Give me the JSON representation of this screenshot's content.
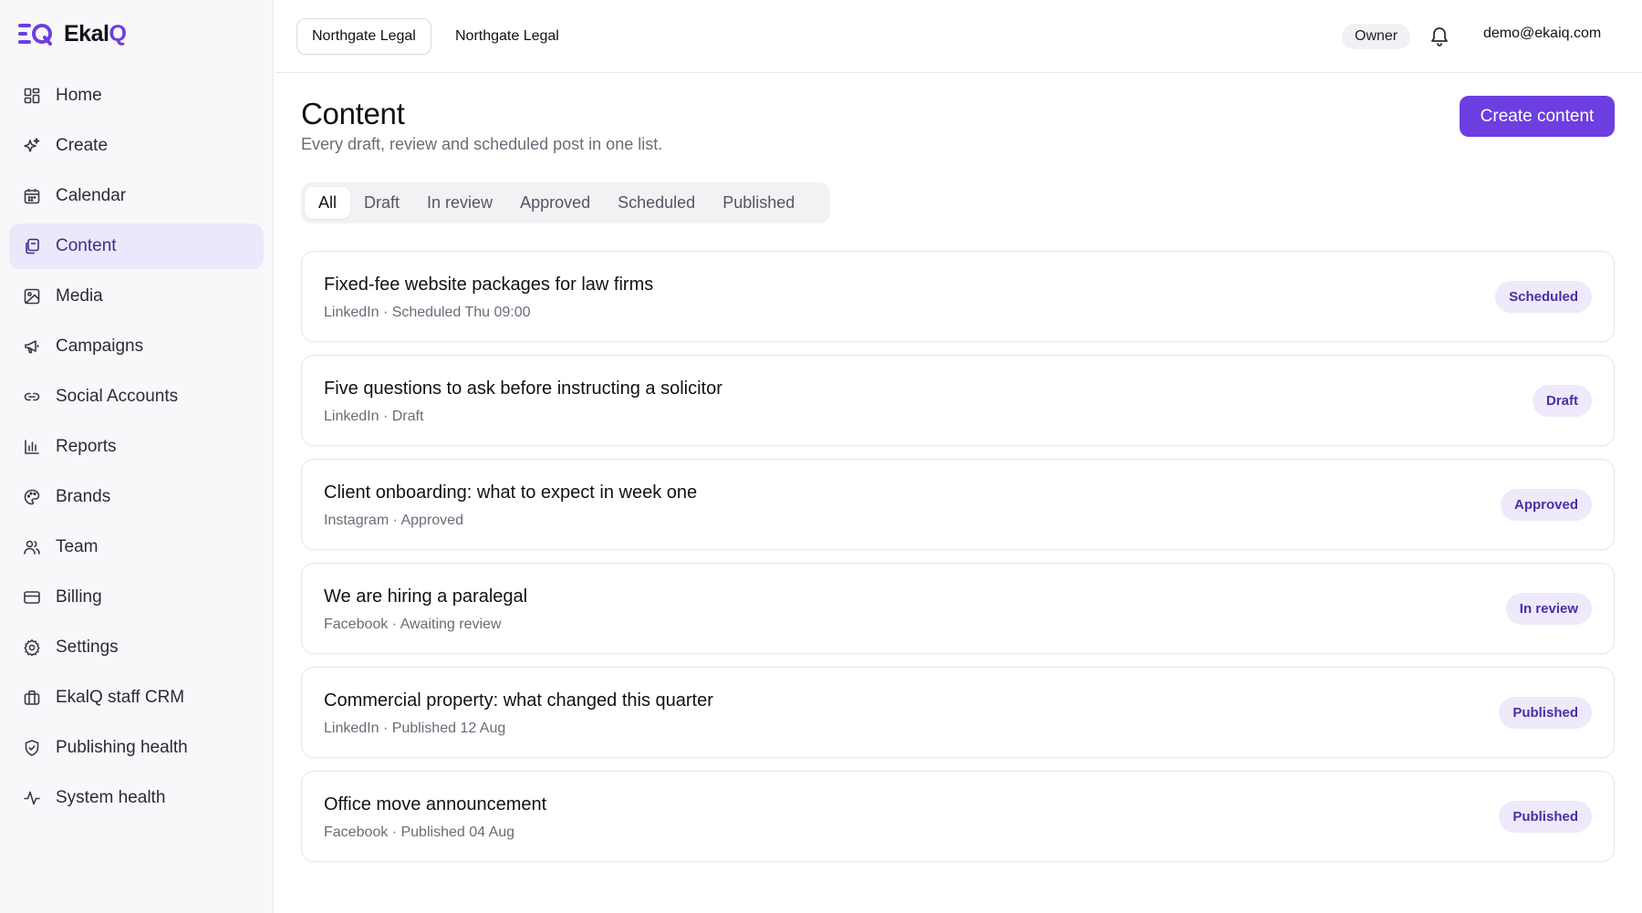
{
  "app": {
    "logo_text_main": "Ekal",
    "logo_text_accent": "Q",
    "brand_color": "#6d3ee0"
  },
  "sidebar": {
    "items": [
      {
        "label": "Home",
        "icon": "home-grid-icon"
      },
      {
        "label": "Create",
        "icon": "sparkles-icon"
      },
      {
        "label": "Calendar",
        "icon": "calendar-icon"
      },
      {
        "label": "Content",
        "icon": "documents-icon",
        "active": true
      },
      {
        "label": "Media",
        "icon": "image-icon"
      },
      {
        "label": "Campaigns",
        "icon": "megaphone-icon"
      },
      {
        "label": "Social Accounts",
        "icon": "link-icon"
      },
      {
        "label": "Reports",
        "icon": "bar-chart-icon"
      },
      {
        "label": "Brands",
        "icon": "palette-icon"
      },
      {
        "label": "Team",
        "icon": "users-icon"
      },
      {
        "label": "Billing",
        "icon": "credit-card-icon"
      },
      {
        "label": "Settings",
        "icon": "gear-icon"
      },
      {
        "label": "EkalQ staff CRM",
        "icon": "briefcase-icon"
      },
      {
        "label": "Publishing health",
        "icon": "shield-icon"
      },
      {
        "label": "System health",
        "icon": "activity-icon"
      }
    ]
  },
  "topbar": {
    "workspaces": [
      "Northgate Legal",
      "Northgate Legal"
    ],
    "role": "Owner",
    "bell_icon": "bell-icon",
    "user_email": "demo@ekaiq.com"
  },
  "main": {
    "title": "Content",
    "subtitle": "Every draft, review and scheduled post in one list.",
    "create_button": "Create content",
    "tabs": [
      "All",
      "Draft",
      "In review",
      "Approved",
      "Scheduled",
      "Published"
    ],
    "active_tab": "All",
    "items": [
      {
        "title": "Fixed-fee website packages for law firms",
        "meta": "LinkedIn · Scheduled Thu 09:00",
        "status": "Scheduled"
      },
      {
        "title": "Five questions to ask before instructing a solicitor",
        "meta": "LinkedIn · Draft",
        "status": "Draft"
      },
      {
        "title": "Client onboarding: what to expect in week one",
        "meta": "Instagram · Approved",
        "status": "Approved"
      },
      {
        "title": "We are hiring a paralegal",
        "meta": "Facebook · Awaiting review",
        "status": "In review"
      },
      {
        "title": "Commercial property: what changed this quarter",
        "meta": "LinkedIn · Published 12 Aug",
        "status": "Published"
      },
      {
        "title": "Office move announcement",
        "meta": "Facebook · Published 04 Aug",
        "status": "Published"
      }
    ]
  }
}
